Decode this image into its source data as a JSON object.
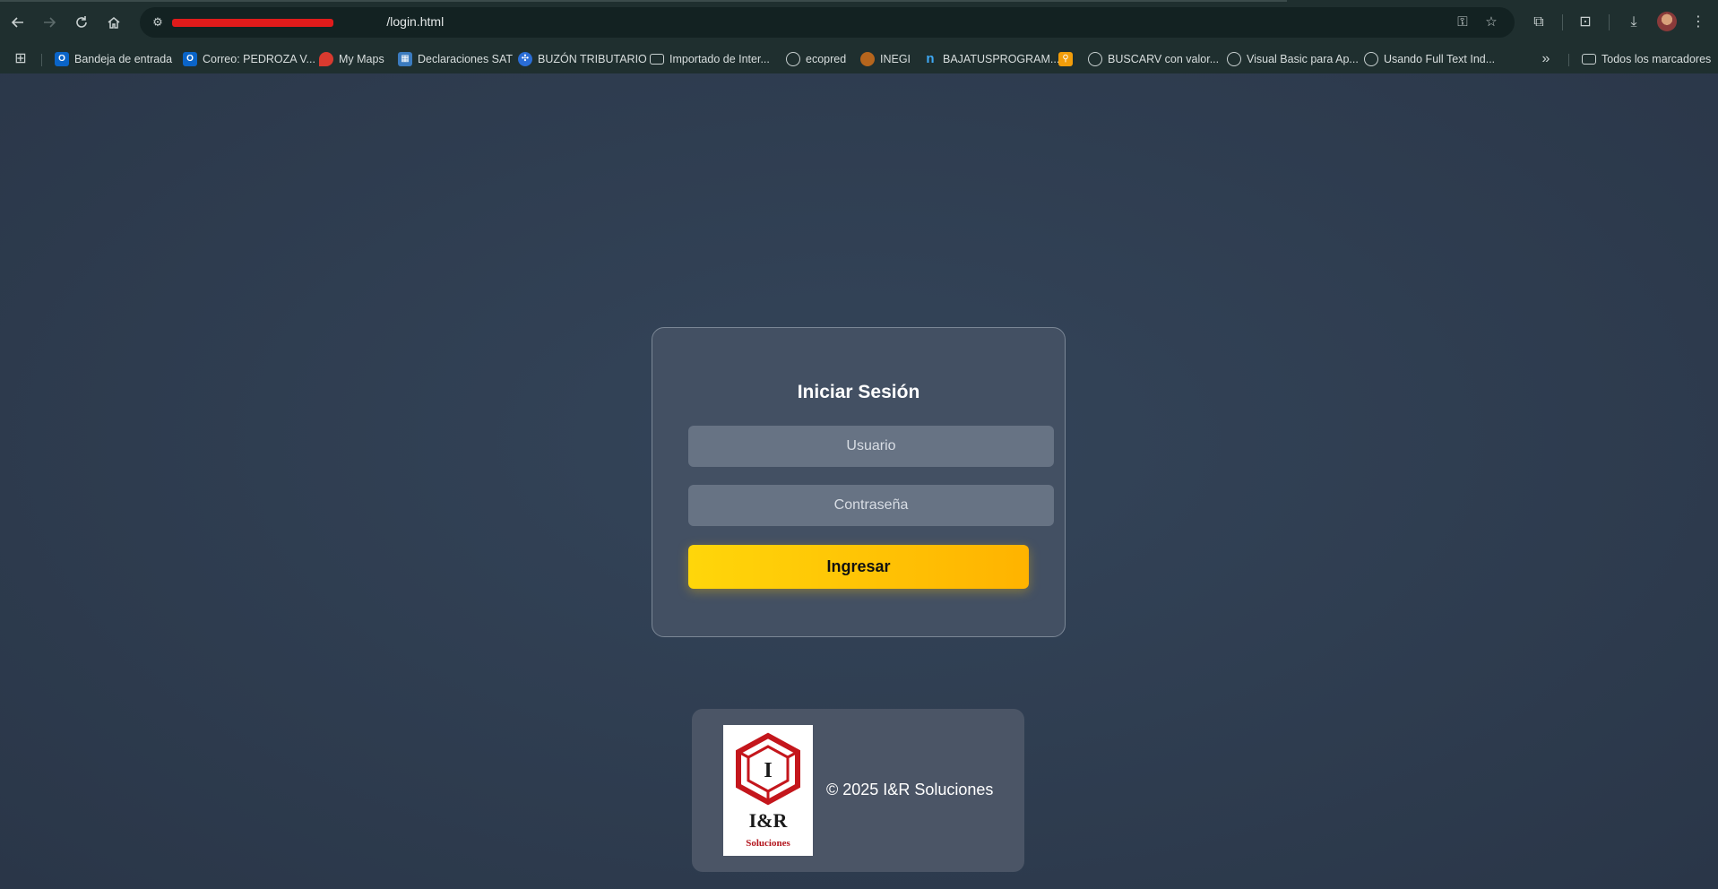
{
  "browser": {
    "url_visible_suffix": "/login.html",
    "bookmarks": [
      {
        "label": "Bandeja de entrada",
        "icon": "outlook-icon"
      },
      {
        "label": "Correo: PEDROZA V...",
        "icon": "outlook-icon"
      },
      {
        "label": "My Maps",
        "icon": "maps-pin-icon"
      },
      {
        "label": "Declaraciones SAT",
        "icon": "sat-icon"
      },
      {
        "label": "BUZÓN TRIBUTARIO",
        "icon": "buzon-icon"
      },
      {
        "label": "Importado de Inter...",
        "icon": "folder-icon"
      },
      {
        "label": "ecopred",
        "icon": "globe-icon"
      },
      {
        "label": "INEGI",
        "icon": "inegi-icon"
      },
      {
        "label": "BAJATUSPROGRAM...",
        "icon": "n-icon"
      },
      {
        "label": "",
        "icon": "magnifier-icon"
      },
      {
        "label": "BUSCARV con valor...",
        "icon": "globe-icon"
      },
      {
        "label": "Visual Basic para Ap...",
        "icon": "globe-icon"
      },
      {
        "label": "Usando Full Text Ind...",
        "icon": "globe-icon"
      }
    ],
    "all_bookmarks_label": "Todos los marcadores"
  },
  "login": {
    "title": "Iniciar Sesión",
    "username_placeholder": "Usuario",
    "password_placeholder": "Contraseña",
    "submit_label": "Ingresar"
  },
  "footer": {
    "logo_wordmark": "I&R",
    "logo_subtitle": "Soluciones",
    "copyright": "© 2025 I&R Soluciones"
  },
  "colors": {
    "page_background": "#2f3d51",
    "card_background": "#435063",
    "button_gradient_start": "#ffd60a",
    "button_gradient_end": "#ffb300",
    "logo_red": "#c4161c"
  }
}
